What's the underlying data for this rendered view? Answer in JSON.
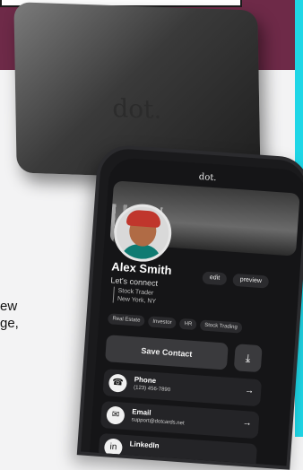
{
  "card": {
    "logo": "dot."
  },
  "side_text": {
    "line1": "ew",
    "line2": "ge,"
  },
  "phone": {
    "header_logo": "dot.",
    "profile": {
      "name": "Alex Smith",
      "tagline": "Let's connect",
      "title": "Stock Trader",
      "location": "New York, NY"
    },
    "buttons": {
      "edit": "edit",
      "preview": "preview",
      "save": "Save Contact",
      "download_icon": "download-icon"
    },
    "chips": [
      "Real Estate",
      "Investor",
      "HR",
      "Stock Trading"
    ],
    "contacts": [
      {
        "label": "Phone",
        "value": "(123) 456-7890",
        "icon": "phone-icon"
      },
      {
        "label": "Email",
        "value": "support@dotcards.net",
        "icon": "email-icon"
      },
      {
        "label": "LinkedIn",
        "value": "",
        "icon": "linkedin-icon"
      }
    ]
  },
  "colors": {
    "band": "#6e2a48",
    "accent_edge": "#1fd6e6",
    "phone_bg": "#151517"
  }
}
